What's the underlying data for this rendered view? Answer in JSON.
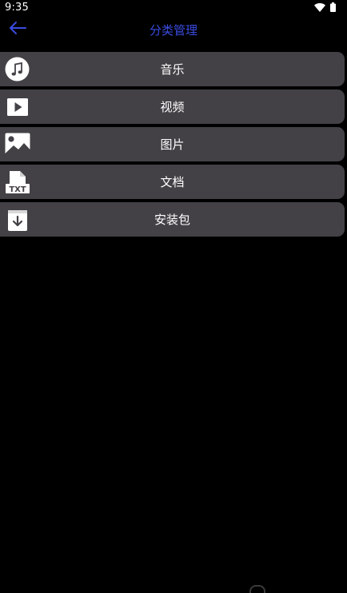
{
  "status_bar": {
    "time": "9:35",
    "icons": [
      "wifi-icon",
      "battery-icon"
    ]
  },
  "app_bar": {
    "back_icon": "arrow-left-icon",
    "title": "分类管理",
    "title_color": "#3a4be0"
  },
  "categories": [
    {
      "label": "音乐",
      "icon": "music-icon"
    },
    {
      "label": "视频",
      "icon": "video-play-icon"
    },
    {
      "label": "图片",
      "icon": "image-icon"
    },
    {
      "label": "文档",
      "icon": "txt-document-icon"
    },
    {
      "label": "安装包",
      "icon": "download-package-icon"
    }
  ],
  "colors": {
    "background": "#000000",
    "item_background": "#444146",
    "text": "#ffffff"
  }
}
